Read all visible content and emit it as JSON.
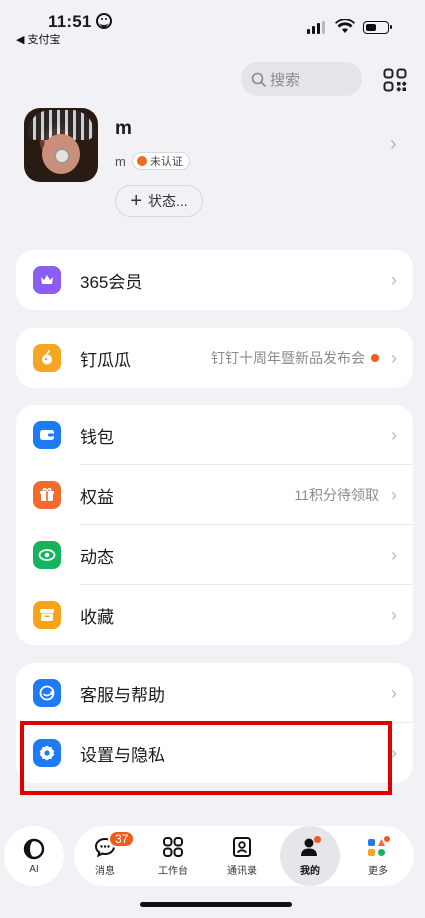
{
  "status_bar": {
    "time": "11:51",
    "back_app": "◀ 支付宝"
  },
  "header": {
    "search_placeholder": "搜索"
  },
  "profile": {
    "name": "m",
    "sub_name": "m",
    "verify_badge": "未认证",
    "status_button": "状态..."
  },
  "cards": {
    "member": {
      "label": "365会员"
    },
    "dingguagua": {
      "label": "钉瓜瓜",
      "hint": "钉钉十周年暨新品发布会"
    },
    "wallet": {
      "label": "钱包"
    },
    "benefits": {
      "label": "权益",
      "hint": "11积分待领取"
    },
    "moments": {
      "label": "动态"
    },
    "favorites": {
      "label": "收藏"
    },
    "support": {
      "label": "客服与帮助"
    },
    "settings": {
      "label": "设置与隐私"
    }
  },
  "tabbar": {
    "ai": "AI",
    "messages": "消息",
    "messages_badge": "37",
    "workbench": "工作台",
    "contacts": "通讯录",
    "me": "我的",
    "more": "更多"
  },
  "colors": {
    "accent_orange": "#ef5a1d",
    "highlight_red": "#e00000",
    "member_icon": "#8b5cf6",
    "dingguagua_icon": "#f5a623",
    "wallet_icon": "#1e7bf5",
    "benefits_icon": "#f06b2d",
    "moments_icon": "#15b35a",
    "favorites_icon": "#f7a21b",
    "support_icon": "#1e7bf5",
    "settings_icon": "#1e7bf5"
  }
}
